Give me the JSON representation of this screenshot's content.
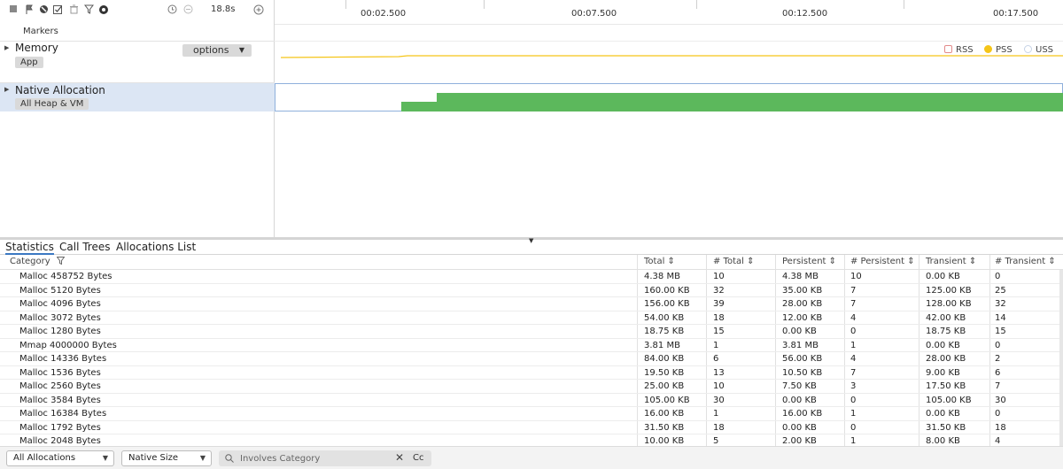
{
  "toolbar": {
    "icons": [
      "stop-icon",
      "flag-icon",
      "block-icon",
      "checklist-icon",
      "trash-icon",
      "filter-icon",
      "settings-icon",
      "record-timer-icon",
      "zoom-out-icon",
      "zoom-in-icon"
    ],
    "duration": "18.8s"
  },
  "tracks": {
    "markers_label": "Markers",
    "memory": {
      "label": "Memory",
      "chip": "App",
      "options_label": "options"
    },
    "native": {
      "label": "Native Allocation",
      "chip": "All Heap & VM"
    }
  },
  "timeline": {
    "ticks": [
      "00:02.500",
      "00:07.500",
      "00:12.500",
      "00:17.500"
    ],
    "legend": [
      {
        "label": "RSS",
        "color": "#ffffff",
        "border": "#e28a8a"
      },
      {
        "label": "PSS",
        "color": "#f5c518",
        "border": "#f5c518"
      },
      {
        "label": "USS",
        "color": "#ffffff",
        "border": "#c7d3e6"
      }
    ],
    "pss_color": "#f5c518",
    "native_color": "#5cb85c"
  },
  "tabs": [
    "Statistics",
    "Call Trees",
    "Allocations List"
  ],
  "table": {
    "columns": [
      "Category",
      "Total",
      "# Total",
      "Persistent",
      "# Persistent",
      "Transient",
      "# Transient"
    ],
    "rows": [
      [
        "Malloc 458752 Bytes",
        "4.38 MB",
        "10",
        "4.38 MB",
        "10",
        "0.00 KB",
        "0"
      ],
      [
        "Malloc 5120 Bytes",
        "160.00 KB",
        "32",
        "35.00 KB",
        "7",
        "125.00 KB",
        "25"
      ],
      [
        "Malloc 4096 Bytes",
        "156.00 KB",
        "39",
        "28.00 KB",
        "7",
        "128.00 KB",
        "32"
      ],
      [
        "Malloc 3072 Bytes",
        "54.00 KB",
        "18",
        "12.00 KB",
        "4",
        "42.00 KB",
        "14"
      ],
      [
        "Malloc 1280 Bytes",
        "18.75 KB",
        "15",
        "0.00 KB",
        "0",
        "18.75 KB",
        "15"
      ],
      [
        "Mmap 4000000 Bytes",
        "3.81 MB",
        "1",
        "3.81 MB",
        "1",
        "0.00 KB",
        "0"
      ],
      [
        "Malloc 14336 Bytes",
        "84.00 KB",
        "6",
        "56.00 KB",
        "4",
        "28.00 KB",
        "2"
      ],
      [
        "Malloc 1536 Bytes",
        "19.50 KB",
        "13",
        "10.50 KB",
        "7",
        "9.00 KB",
        "6"
      ],
      [
        "Malloc 2560 Bytes",
        "25.00 KB",
        "10",
        "7.50 KB",
        "3",
        "17.50 KB",
        "7"
      ],
      [
        "Malloc 3584 Bytes",
        "105.00 KB",
        "30",
        "0.00 KB",
        "0",
        "105.00 KB",
        "30"
      ],
      [
        "Malloc 16384 Bytes",
        "16.00 KB",
        "1",
        "16.00 KB",
        "1",
        "0.00 KB",
        "0"
      ],
      [
        "Malloc 1792 Bytes",
        "31.50 KB",
        "18",
        "0.00 KB",
        "0",
        "31.50 KB",
        "18"
      ],
      [
        "Malloc 2048 Bytes",
        "10.00 KB",
        "5",
        "2.00 KB",
        "1",
        "8.00 KB",
        "4"
      ]
    ]
  },
  "bottom": {
    "scope_select": "All Allocations",
    "size_select": "Native Size",
    "search_placeholder": "Involves Category",
    "case_toggle": "Cc"
  }
}
